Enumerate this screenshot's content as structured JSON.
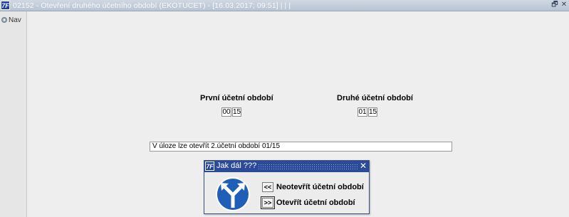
{
  "window": {
    "title": "02152 - Otevření druhého účetního období (EKOTUCET) - [16.03.2017; 09:51] | | |",
    "app_icon": "7F",
    "restore_label": "🗗",
    "close_label": "✕"
  },
  "sidebar": {
    "nav_label": "Nav"
  },
  "form": {
    "first_period_label": "První účetní období",
    "first_period_values": [
      "00",
      "15"
    ],
    "second_period_label": "Druhé účetní období",
    "second_period_values": [
      "01",
      "15"
    ],
    "message": "V úloze lze otevřít 2.účetní období 01/15"
  },
  "dialog": {
    "title": "Jak dál ???",
    "close_label": "✕",
    "options": [
      {
        "button": "<<",
        "label": "Neotevřít účetní období"
      },
      {
        "button": ">>",
        "label": "Otevřít účetní období"
      }
    ],
    "sign_icon": "road-fork-sign-icon",
    "sign_color": "#1f5fb8"
  }
}
